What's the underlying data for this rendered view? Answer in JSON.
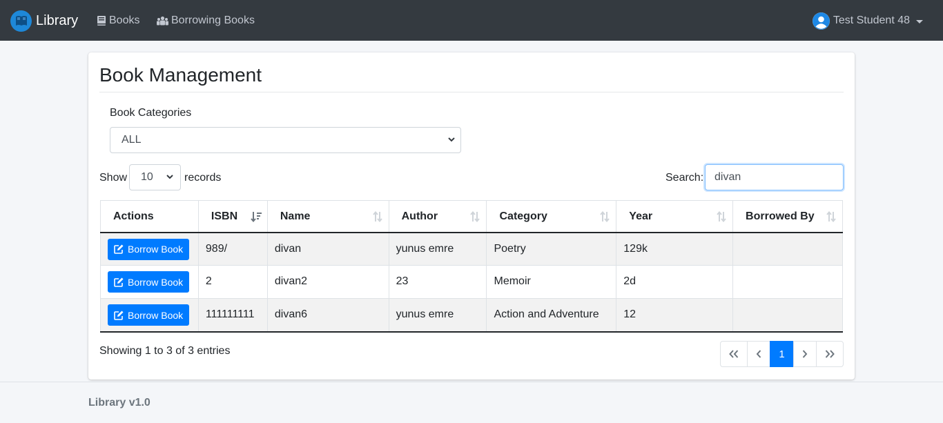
{
  "navbar": {
    "brand": "Library",
    "links": [
      {
        "label": "Books",
        "icon": "book-icon"
      },
      {
        "label": "Borrowing Books",
        "icon": "people-icon"
      }
    ],
    "user": {
      "name": "Test Student 48",
      "icon": "user-avatar-icon"
    }
  },
  "page": {
    "title": "Book Management",
    "category_label": "Book Categories",
    "category_selected": "ALL",
    "show_label": "Show",
    "show_value": "10",
    "records_label": "records",
    "search_label": "Search:",
    "search_value": "divan"
  },
  "table": {
    "columns": [
      "Actions",
      "ISBN",
      "Name",
      "Author",
      "Category",
      "Year",
      "Borrowed By"
    ],
    "action_label": "Borrow Book",
    "rows": [
      {
        "isbn": "989/",
        "name": "divan",
        "author": "yunus emre",
        "category": "Poetry",
        "year": "129k",
        "borrowed_by": ""
      },
      {
        "isbn": "2",
        "name": "divan2",
        "author": "23",
        "category": "Memoir",
        "year": "2d",
        "borrowed_by": ""
      },
      {
        "isbn": "111111111",
        "name": "divan6",
        "author": "yunus emre",
        "category": "Action and Adventure",
        "year": "12",
        "borrowed_by": ""
      }
    ]
  },
  "footer_info": "Showing 1 to 3 of 3 entries",
  "pagination": {
    "current": "1"
  },
  "footer": "Library v1.0",
  "colors": {
    "navbar": "#343a40",
    "primary": "#007bff"
  }
}
